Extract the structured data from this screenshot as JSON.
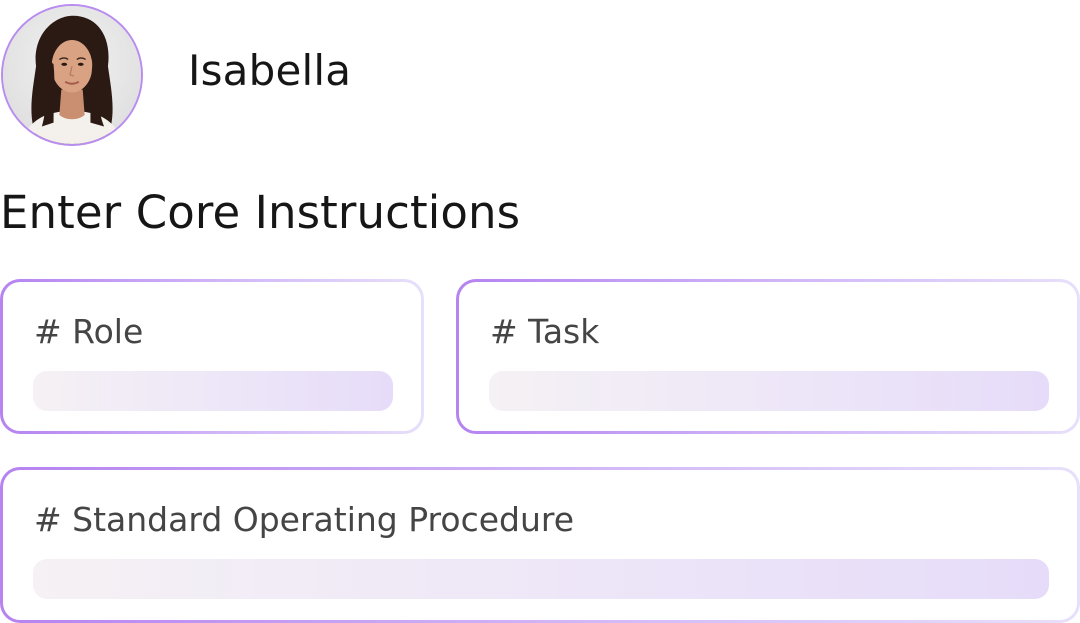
{
  "agent": {
    "name": "Isabella",
    "avatar_icon": "person-portrait"
  },
  "section": {
    "title": "Enter Core Instructions"
  },
  "fields": {
    "role": {
      "label": "# Role",
      "value": ""
    },
    "task": {
      "label": "# Task",
      "value": ""
    },
    "sop": {
      "label": "# Standard Operating Procedure",
      "value": ""
    }
  },
  "colors": {
    "accent": "#b683f1",
    "field_start": "#f5f1f4",
    "field_end": "#e6dcf9",
    "text": "#161616",
    "label": "#454545"
  }
}
